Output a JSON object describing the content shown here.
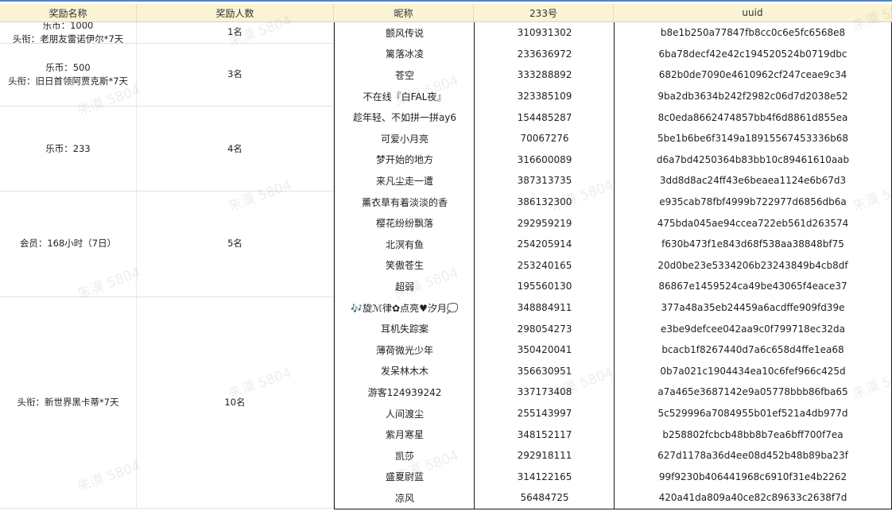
{
  "headers": [
    "奖励名称",
    "奖励人数",
    "昵称",
    "233号",
    "uuid"
  ],
  "groups": [
    {
      "reward": [
        "乐币：1000",
        "头衔：老朋友雷诺伊尔*7天"
      ],
      "count": "1名"
    },
    {
      "reward": [
        "乐币：500",
        "头衔：旧日首领阿贾克斯*7天"
      ],
      "count": "3名"
    },
    {
      "reward": [
        "乐币：233"
      ],
      "count": "4名"
    },
    {
      "reward": [
        "会员：168小时（7日）"
      ],
      "count": "5名"
    },
    {
      "reward": [
        "头衔：新世界黑卡蒂*7天"
      ],
      "count": "10名"
    }
  ],
  "rows": [
    {
      "nickname": "颤风传说",
      "id233": "310931302",
      "uuid": "b8e1b250a77847fb8cc0c6e5fc6568e8"
    },
    {
      "nickname": "篱落冰凌",
      "id233": "233636972",
      "uuid": "6ba78decf42e42c194520524b0719dbc"
    },
    {
      "nickname": "苍空",
      "id233": "333288892",
      "uuid": "682b0de7090e4610962cf247ceae9c34"
    },
    {
      "nickname": "不在线『白FAL夜』",
      "id233": "323385109",
      "uuid": "9ba2db3634b242f2982c06d7d2038e52"
    },
    {
      "nickname": "趁年轻、不如拼一拼ay6",
      "id233": "154485287",
      "uuid": "8c0eda8662474857bb4f6d8861d855ea"
    },
    {
      "nickname": "可爱小月亮",
      "id233": "70067276",
      "uuid": "5be1b6be6f3149a18915567453336b68"
    },
    {
      "nickname": "梦开始的地方",
      "id233": "316600089",
      "uuid": "d6a7bd4250364b83bb10c89461610aab"
    },
    {
      "nickname": "来凡尘走一遭",
      "id233": "387313735",
      "uuid": "3dd8d8ac24ff43e6beaea1124e6b67d3"
    },
    {
      "nickname": "薰衣草有着淡淡的香",
      "id233": "386132300",
      "uuid": "e935cab78fbf4999b722977d6856db6a"
    },
    {
      "nickname": "樱花纷纷飘落",
      "id233": "292959219",
      "uuid": "475bda045ae94ccea722eb561d263574"
    },
    {
      "nickname": "北溟有鱼",
      "id233": "254205914",
      "uuid": "f630b473f1e843d68f538aa38848bf75"
    },
    {
      "nickname": "笑傲苍生",
      "id233": "253240165",
      "uuid": "20d0be23e5334206b23243849b4cb8df"
    },
    {
      "nickname": "超弱",
      "id233": "195560130",
      "uuid": "86867e1459524ca49be43065f4eace37"
    },
    {
      "nickname": "🎶旋ℳ律✿点亮♥汐月💭",
      "id233": "348884911",
      "uuid": "377a48a35eb24459a6acdffe909fd39e"
    },
    {
      "nickname": "耳机失踪案",
      "id233": "298054273",
      "uuid": "e3be9defcee042aa9c0f799718ec32da"
    },
    {
      "nickname": "薄荷微光少年",
      "id233": "350420041",
      "uuid": "bcacb1f8267440d7a6c658d4ffe1ea68"
    },
    {
      "nickname": "发呆林木木",
      "id233": "356630951",
      "uuid": "0b7a021c1904434ea10c6fef966c425d"
    },
    {
      "nickname": "游客124939242",
      "id233": "337173408",
      "uuid": "a7a465e3687142e9a05778bbb86fba65"
    },
    {
      "nickname": "人间渡尘",
      "id233": "255143997",
      "uuid": "5c529996a7084955b01ef521a4db977d"
    },
    {
      "nickname": "紫月寒星",
      "id233": "348152117",
      "uuid": "b258802fcbcb48bb8b7ea6bff700f7ea"
    },
    {
      "nickname": "凯莎",
      "id233": "292918111",
      "uuid": "627d1178a36d4ee08d452b48b89ba23f"
    },
    {
      "nickname": "盛夏尉蓝",
      "id233": "314122165",
      "uuid": "99f9230b406441968c6910f31e4b2262"
    },
    {
      "nickname": "凉风",
      "id233": "56484725",
      "uuid": "420a41da809a40ce82c89633c2638f7d"
    }
  ],
  "watermark": "朱漠 5804"
}
